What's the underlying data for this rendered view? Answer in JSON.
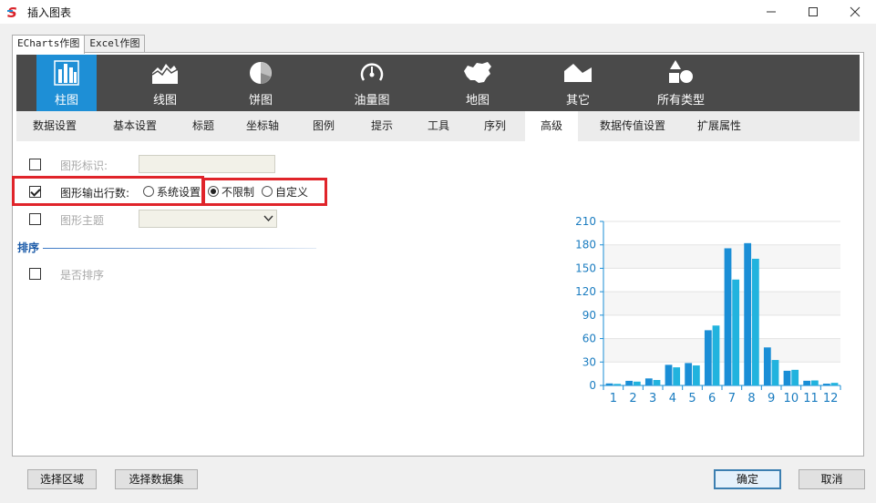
{
  "window": {
    "title": "插入图表"
  },
  "outer_tabs": [
    "ECharts作图",
    "Excel作图"
  ],
  "chart_types": [
    {
      "label": "柱图",
      "icon": "bar-chart-icon",
      "active": true
    },
    {
      "label": "线图",
      "icon": "line-chart-icon",
      "active": false
    },
    {
      "label": "饼图",
      "icon": "pie-chart-icon",
      "active": false
    },
    {
      "label": "油量图",
      "icon": "gauge-icon",
      "active": false
    },
    {
      "label": "地图",
      "icon": "map-icon",
      "active": false
    },
    {
      "label": "其它",
      "icon": "other-chart-icon",
      "active": false
    },
    {
      "label": "所有类型",
      "icon": "all-types-icon",
      "active": false
    }
  ],
  "sub_tabs": [
    "数据设置",
    "基本设置",
    "标题",
    "坐标轴",
    "图例",
    "提示",
    "工具",
    "序列",
    "高级",
    "数据传值设置",
    "扩展属性"
  ],
  "active_sub_tab": "高级",
  "options": {
    "graph_id_label": "图形标识:",
    "output_rows_label": "图形输出行数:",
    "radio_system": "系统设置",
    "radio_unlimited": "不限制",
    "radio_custom": "自定义",
    "graph_theme_label": "图形主题",
    "sort_section": "排序",
    "sort_label": "是否排序"
  },
  "chart_data": {
    "type": "bar",
    "categories": [
      "1",
      "2",
      "3",
      "4",
      "5",
      "6",
      "7",
      "8",
      "9",
      "10",
      "11",
      "12"
    ],
    "series": [
      {
        "values": [
          2.6,
          5.9,
          9.0,
          26.4,
          28.7,
          70.7,
          175.6,
          182.2,
          48.7,
          18.8,
          6.0,
          2.3
        ]
      },
      {
        "values": [
          2.0,
          4.9,
          7.0,
          23.2,
          25.6,
          76.7,
          135.6,
          162.2,
          32.6,
          20.0,
          6.4,
          3.3
        ]
      }
    ],
    "ylim": [
      0,
      210
    ],
    "yticks": [
      0,
      30,
      60,
      90,
      120,
      150,
      180,
      210
    ],
    "colors": [
      "#1a8ed6",
      "#21b3de"
    ],
    "grid": true,
    "title": "",
    "xlabel": "",
    "ylabel": ""
  },
  "buttons": {
    "select_area": "选择区域",
    "select_dataset": "选择数据集",
    "ok": "确定",
    "cancel": "取消"
  },
  "colors": {
    "accent": "#1e8fd6",
    "toolbar": "#4a4a4a",
    "highlight": "#e0242a",
    "section": "#1a5aa8"
  }
}
